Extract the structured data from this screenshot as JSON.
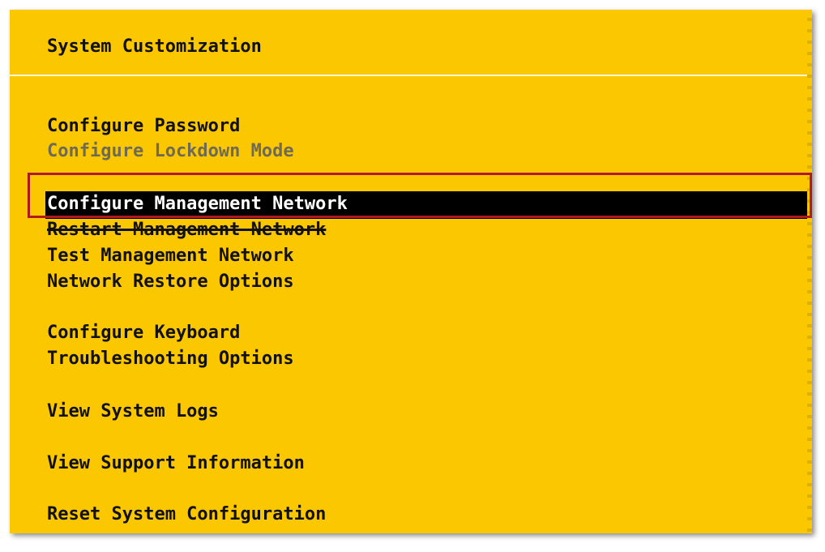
{
  "header": {
    "title": "System Customization"
  },
  "menu": {
    "items": [
      {
        "label": "Configure Password"
      },
      {
        "label": "Configure Lockdown Mode"
      },
      {
        "label": "Configure Management Network"
      },
      {
        "label": "Restart Management Network"
      },
      {
        "label": "Test Management Network"
      },
      {
        "label": "Network Restore Options"
      },
      {
        "label": "Configure Keyboard"
      },
      {
        "label": "Troubleshooting Options"
      },
      {
        "label": "View System Logs"
      },
      {
        "label": "View Support Information"
      },
      {
        "label": "Reset System Configuration"
      }
    ]
  },
  "colors": {
    "background": "#fbc700",
    "selected_bg": "#000000",
    "selected_fg": "#ffffff",
    "disabled_fg": "#6f6a56",
    "annotation_box": "#b01822"
  }
}
